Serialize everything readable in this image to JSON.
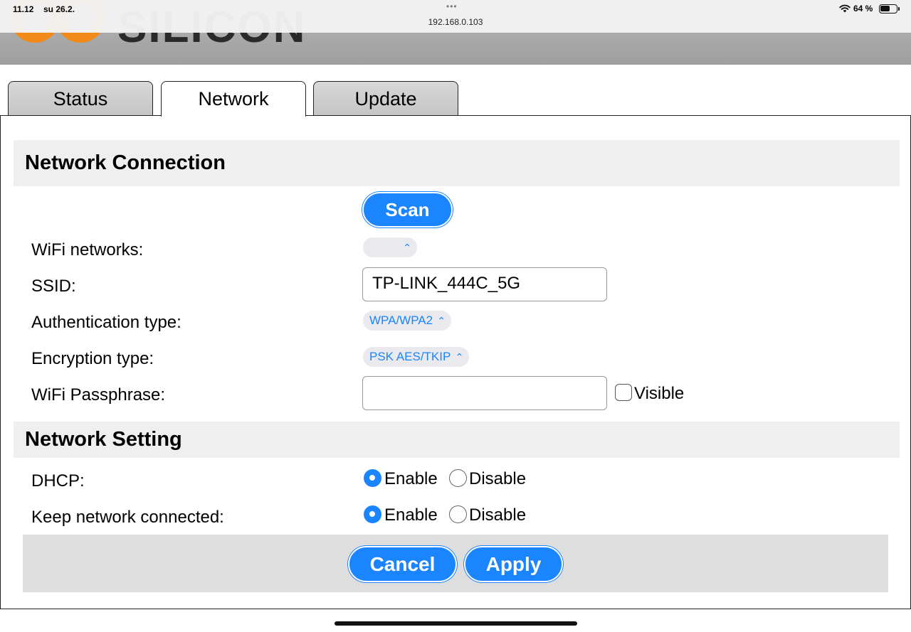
{
  "status_bar": {
    "time": "11.12",
    "date": "su 26.2.",
    "url": "192.168.0.103",
    "battery": "64 %",
    "battery_level_percent": 64,
    "wifi_icon": "wifi-icon",
    "more_icon": "more-dots-icon"
  },
  "brand": {
    "logo_text": "SILICON",
    "logo_color": "#f28a1a"
  },
  "tabs": [
    {
      "label": "Status",
      "active": false
    },
    {
      "label": "Network",
      "active": true
    },
    {
      "label": "Update",
      "active": false
    }
  ],
  "network_connection": {
    "title": "Network Connection",
    "scan_label": "Scan",
    "wifi_networks_label": "WiFi networks:",
    "wifi_networks_value": "",
    "ssid_label": "SSID:",
    "ssid_value": "TP-LINK_444C_5G",
    "auth_label": "Authentication type:",
    "auth_value": "WPA/WPA2",
    "enc_label": "Encryption type:",
    "enc_value": "PSK AES/TKIP",
    "pass_label": "WiFi Passphrase:",
    "pass_value": "",
    "visible_label": "Visible",
    "visible_checked": false
  },
  "network_setting": {
    "title": "Network Setting",
    "dhcp_label": "DHCP:",
    "dhcp_enable": "Enable",
    "dhcp_disable": "Disable",
    "dhcp_selected": "Enable",
    "keep_label": "Keep network connected:",
    "keep_enable": "Enable",
    "keep_disable": "Disable",
    "keep_selected": "Enable"
  },
  "footer": {
    "cancel_label": "Cancel",
    "apply_label": "Apply"
  },
  "colors": {
    "accent": "#1a85ff",
    "section_bg": "#efefef",
    "footer_bg": "#dedede"
  }
}
